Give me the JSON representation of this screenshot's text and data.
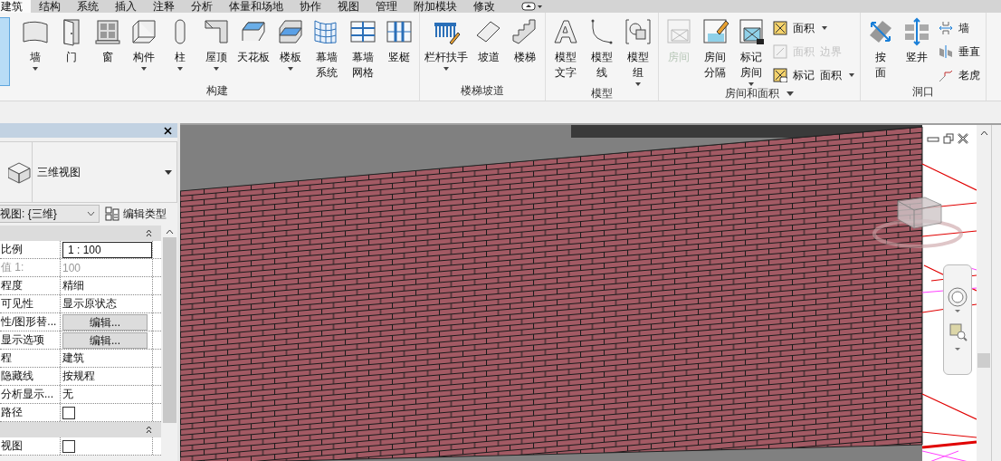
{
  "tabs": [
    {
      "label": "建筑",
      "selected": true
    },
    {
      "label": "结构",
      "selected": false
    },
    {
      "label": "系统",
      "selected": false
    },
    {
      "label": "插入",
      "selected": false
    },
    {
      "label": "注释",
      "selected": false
    },
    {
      "label": "分析",
      "selected": false
    },
    {
      "label": "体量和场地",
      "selected": false
    },
    {
      "label": "协作",
      "selected": false
    },
    {
      "label": "视图",
      "selected": false
    },
    {
      "label": "管理",
      "selected": false
    },
    {
      "label": "附加模块",
      "selected": false
    },
    {
      "label": "修改",
      "selected": false
    }
  ],
  "ribbon": {
    "groups": [
      {
        "title": "构建",
        "menu": false,
        "items": [
          {
            "kind": "large",
            "lines": [
              "墙"
            ],
            "dropdown": true,
            "disabled": false
          },
          {
            "kind": "large",
            "lines": [
              "门"
            ],
            "dropdown": false,
            "disabled": false
          },
          {
            "kind": "large",
            "lines": [
              "窗"
            ],
            "dropdown": false,
            "disabled": false
          },
          {
            "kind": "large",
            "lines": [
              "构件"
            ],
            "dropdown": true,
            "disabled": false
          },
          {
            "kind": "large",
            "lines": [
              "柱"
            ],
            "dropdown": true,
            "disabled": false
          },
          {
            "kind": "large",
            "lines": [
              "屋顶"
            ],
            "dropdown": true,
            "disabled": false
          },
          {
            "kind": "large",
            "lines": [
              "天花板"
            ],
            "dropdown": false,
            "disabled": false
          },
          {
            "kind": "large",
            "lines": [
              "楼板"
            ],
            "dropdown": true,
            "disabled": false
          },
          {
            "kind": "large",
            "lines": [
              "幕墙",
              "系统"
            ],
            "dropdown": false,
            "disabled": false
          },
          {
            "kind": "large",
            "lines": [
              "幕墙",
              "网格"
            ],
            "dropdown": false,
            "disabled": false
          },
          {
            "kind": "large",
            "lines": [
              "竖梃"
            ],
            "dropdown": false,
            "disabled": false
          }
        ]
      },
      {
        "title": "楼梯坡道",
        "menu": false,
        "items": [
          {
            "kind": "large",
            "lines": [
              "栏杆扶手"
            ],
            "dropdown": true,
            "disabled": false
          },
          {
            "kind": "large",
            "lines": [
              "坡道"
            ],
            "dropdown": false,
            "disabled": false
          },
          {
            "kind": "large",
            "lines": [
              "楼梯"
            ],
            "dropdown": false,
            "disabled": false
          }
        ]
      },
      {
        "title": "模型",
        "menu": false,
        "items": [
          {
            "kind": "large",
            "lines": [
              "模型",
              "文字"
            ],
            "dropdown": false,
            "disabled": false
          },
          {
            "kind": "large",
            "lines": [
              "模型",
              "线"
            ],
            "dropdown": false,
            "disabled": false
          },
          {
            "kind": "large",
            "lines": [
              "模型",
              "组"
            ],
            "dropdown": true,
            "disabled": false
          }
        ]
      },
      {
        "title": "房间和面积",
        "menu": true,
        "items": [
          {
            "kind": "large",
            "lines": [
              "房间"
            ],
            "dropdown": false,
            "disabled": true
          },
          {
            "kind": "large",
            "lines": [
              "房间",
              "分隔"
            ],
            "dropdown": false,
            "disabled": false
          },
          {
            "kind": "large",
            "lines": [
              "标记",
              "房间"
            ],
            "dropdown": true,
            "disabled": false
          },
          {
            "kind": "small",
            "labels": [
              "面积"
            ],
            "dropdown": true,
            "disabled": false
          },
          {
            "kind": "small",
            "labels": [
              "面积",
              "边界"
            ],
            "dropdown": false,
            "disabled": true
          },
          {
            "kind": "small",
            "labels": [
              "标记",
              "面积"
            ],
            "dropdown": true,
            "disabled": false
          }
        ]
      },
      {
        "title": "洞口",
        "menu": false,
        "items": [
          {
            "kind": "large",
            "lines": [
              "按",
              "面"
            ],
            "dropdown": false,
            "disabled": false
          },
          {
            "kind": "large",
            "lines": [
              "竖井"
            ],
            "dropdown": false,
            "disabled": false
          },
          {
            "kind": "small",
            "labels": [
              "墙"
            ],
            "dropdown": false,
            "disabled": false
          },
          {
            "kind": "small",
            "labels": [
              "垂直"
            ],
            "dropdown": false,
            "disabled": false
          },
          {
            "kind": "small",
            "labels": [
              "老虎"
            ],
            "dropdown": false,
            "disabled": false
          }
        ]
      }
    ]
  },
  "properties": {
    "type_name": "三维视图",
    "instance_selector": "视图: {三维}",
    "edit_type": "编辑类型",
    "sections": [
      {
        "expanded": true,
        "rows": [
          {
            "label": "比例",
            "kind": "input",
            "value": "1 : 100",
            "disabled": false
          },
          {
            "label": "值 1:",
            "kind": "text",
            "value": "100",
            "disabled": true
          },
          {
            "label": "程度",
            "kind": "text",
            "value": "精细",
            "disabled": false
          },
          {
            "label": "可见性",
            "kind": "text",
            "value": "显示原状态",
            "disabled": false
          },
          {
            "label": "性/图形替...",
            "kind": "button",
            "value": "编辑...",
            "disabled": false
          },
          {
            "label": "显示选项",
            "kind": "button",
            "value": "编辑...",
            "disabled": false
          },
          {
            "label": "程",
            "kind": "text",
            "value": "建筑",
            "disabled": false
          },
          {
            "label": "隐藏线",
            "kind": "text",
            "value": "按规程",
            "disabled": false
          },
          {
            "label": "分析显示...",
            "kind": "text",
            "value": "无",
            "disabled": false
          },
          {
            "label": "路径",
            "kind": "checkbox",
            "checked": false,
            "disabled": false
          }
        ]
      },
      {
        "expanded": true,
        "rows": [
          {
            "label": "视图",
            "kind": "checkbox",
            "checked": false,
            "disabled": false
          }
        ]
      }
    ]
  }
}
